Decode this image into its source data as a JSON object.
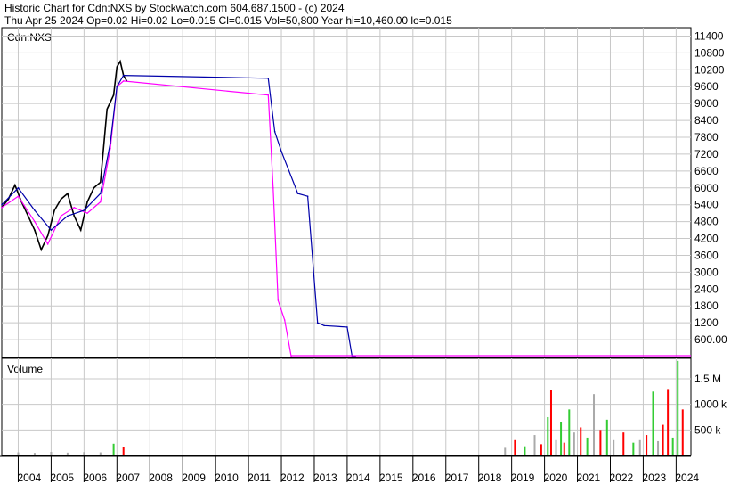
{
  "header": {
    "title_line": "Historic Chart for Cdn:NXS by Stockwatch.com 604.687.1500 - (c) 2024",
    "stats_line": "Thu Apr 25 2024   Op=0.02  Hi=0.02  Lo=0.015  Cl=0.015  Vol=50,800   Year hi=10,460.00   lo=0.015"
  },
  "chart_data": [
    {
      "type": "line",
      "title": "Cdn:NXS",
      "ylim": [
        0,
        11700
      ],
      "yticks": [
        600,
        1200,
        1800,
        2400,
        3000,
        3600,
        4200,
        4800,
        5400,
        6000,
        6600,
        7200,
        7800,
        8400,
        9000,
        9600,
        10200,
        10800,
        11400
      ],
      "ytick_labels": [
        "600.00",
        "1200",
        "1800",
        "2400",
        "3000",
        "3600",
        "4200",
        "4800",
        "5400",
        "6000",
        "6600",
        "7200",
        "7800",
        "8400",
        "9000",
        "9600",
        "10200",
        "10800",
        "11400"
      ],
      "x_year_labels": [
        "2004",
        "2005",
        "2006",
        "2007",
        "2008",
        "2009",
        "2010",
        "2011",
        "2012",
        "2013",
        "2014",
        "2015",
        "2016",
        "2017",
        "2018",
        "2019",
        "2020",
        "2021",
        "2022",
        "2023",
        "2024"
      ],
      "series": [
        {
          "role": "price",
          "color": "#000000",
          "x": [
            2003.5,
            2003.7,
            2003.9,
            2004.1,
            2004.3,
            2004.5,
            2004.7,
            2004.9,
            2005.1,
            2005.3,
            2005.5,
            2005.7,
            2005.9,
            2006.1,
            2006.3,
            2006.5,
            2006.7,
            2006.9,
            2007.0,
            2007.1,
            2007.2,
            2007.3
          ],
          "y": [
            5300,
            5600,
            6100,
            5500,
            5000,
            4500,
            3800,
            4300,
            5200,
            5600,
            5800,
            5000,
            4500,
            5500,
            6000,
            6200,
            8800,
            9300,
            10300,
            10500,
            10000,
            9800
          ]
        },
        {
          "role": "moving-average",
          "color": "#ff00ff",
          "x": [
            2003.5,
            2004.0,
            2004.5,
            2004.9,
            2005.3,
            2005.7,
            2006.1,
            2006.5,
            2006.8,
            2007.0,
            2007.2,
            2011.6,
            2011.75,
            2011.9,
            2012.1,
            2012.3
          ],
          "y": [
            5300,
            5700,
            4800,
            4000,
            5000,
            5300,
            5100,
            5500,
            7400,
            9600,
            9800,
            9300,
            6000,
            2000,
            1300,
            0
          ]
        },
        {
          "role": "moving-average",
          "color": "#0000aa",
          "x": [
            2003.5,
            2004.0,
            2004.5,
            2005.0,
            2005.5,
            2006.0,
            2006.5,
            2006.8,
            2007.0,
            2007.2,
            2011.6,
            2011.8,
            2012.0,
            2012.5,
            2012.8,
            2013.1,
            2013.3,
            2014.0,
            2014.15,
            2014.25
          ],
          "y": [
            5400,
            6000,
            5200,
            4500,
            5000,
            5200,
            5800,
            7600,
            9600,
            10000,
            9900,
            8000,
            7300,
            5800,
            5700,
            1200,
            1100,
            1050,
            0,
            0
          ]
        }
      ]
    },
    {
      "type": "bar",
      "title": "Volume",
      "ylim": [
        0,
        1900
      ],
      "yticks": [
        500,
        1000,
        1500
      ],
      "ytick_labels": [
        "500 k",
        "1000 k",
        "1.5 M"
      ],
      "series": [
        {
          "name": "",
          "x": [
            2004.0,
            2004.5,
            2005.0,
            2005.5,
            2006.0,
            2006.5,
            2006.9,
            2007.2,
            2018.8,
            2019.1,
            2019.4,
            2019.7,
            2019.9,
            2020.1,
            2020.2,
            2020.35,
            2020.5,
            2020.6,
            2020.75,
            2020.9,
            2021.1,
            2021.3,
            2021.5,
            2021.7,
            2021.9,
            2022.1,
            2022.4,
            2022.7,
            2022.9,
            2023.1,
            2023.3,
            2023.45,
            2023.6,
            2023.75,
            2023.9,
            2024.05,
            2024.2
          ],
          "values": [
            60,
            50,
            70,
            55,
            65,
            60,
            230,
            170,
            150,
            300,
            180,
            400,
            220,
            750,
            1280,
            300,
            650,
            250,
            900,
            450,
            550,
            350,
            1200,
            500,
            700,
            300,
            450,
            250,
            300,
            400,
            1250,
            280,
            600,
            1300,
            350,
            1850,
            900
          ],
          "colors": [
            "#aaaaaa",
            "#aaaaaa",
            "#aaaaaa",
            "#aaaaaa",
            "#aaaaaa",
            "#aaaaaa",
            "#33cc33",
            "#ff0000",
            "#aaaaaa",
            "#ff0000",
            "#33cc33",
            "#aaaaaa",
            "#ff0000",
            "#33cc33",
            "#ff0000",
            "#aaaaaa",
            "#33cc33",
            "#ff0000",
            "#33cc33",
            "#aaaaaa",
            "#ff0000",
            "#33cc33",
            "#aaaaaa",
            "#ff0000",
            "#33cc33",
            "#aaaaaa",
            "#ff0000",
            "#33cc33",
            "#aaaaaa",
            "#ff0000",
            "#33cc33",
            "#aaaaaa",
            "#ff0000",
            "#ff0000",
            "#33cc33",
            "#33cc33",
            "#ff0000"
          ]
        }
      ]
    }
  ]
}
